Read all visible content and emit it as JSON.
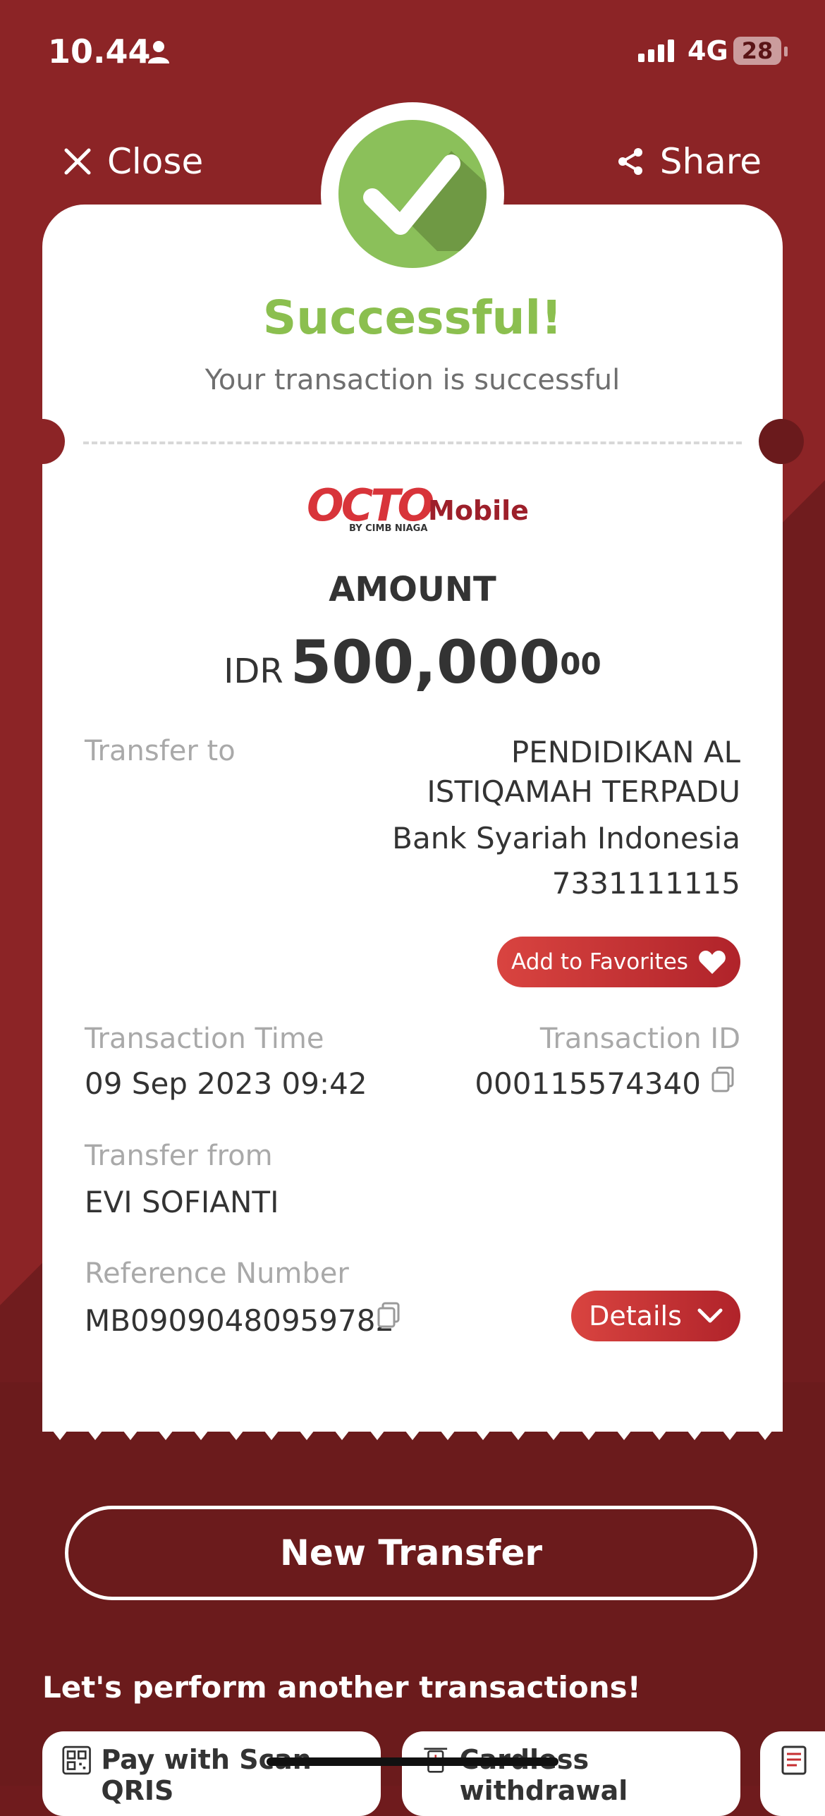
{
  "status_bar": {
    "time": "10.44",
    "network": "4G",
    "battery": "28"
  },
  "header": {
    "close_label": "Close",
    "share_label": "Share"
  },
  "result": {
    "title": "Successful!",
    "subtitle": "Your transaction is successful"
  },
  "brand": {
    "logo_text": "OCTO",
    "logo_suffix": "Mobile",
    "logo_tagline": "BY CIMB NIAGA"
  },
  "amount": {
    "label": "AMOUNT",
    "currency": "IDR",
    "value": "500,000",
    "decimals": "00"
  },
  "transfer_to": {
    "label": "Transfer to",
    "name_line1": "PENDIDIKAN AL",
    "name_line2": "ISTIQAMAH TERPADU",
    "bank": "Bank Syariah Indonesia",
    "account": "7331111115"
  },
  "favorites_button": "Add to Favorites",
  "transaction_time": {
    "label": "Transaction Time",
    "value": "09 Sep 2023 09:42"
  },
  "transaction_id": {
    "label": "Transaction ID",
    "value": "000115574340"
  },
  "transfer_from": {
    "label": "Transfer from",
    "value": "EVI SOFIANTI"
  },
  "reference": {
    "label": "Reference Number",
    "value": "MB09090480959782"
  },
  "details_button": "Details",
  "new_transfer_button": "New Transfer",
  "another_section": {
    "heading": "Let's perform another transactions!",
    "items": [
      {
        "label": "Pay with Scan QRIS",
        "icon": "qr-icon"
      },
      {
        "label": "Cardless withdrawal",
        "icon": "atm-icon"
      },
      {
        "label": "",
        "icon": "receipt-icon"
      }
    ]
  },
  "colors": {
    "brand_red": "#8c2426",
    "success_green": "#8bbf4f",
    "button_red": "#c62f32"
  }
}
